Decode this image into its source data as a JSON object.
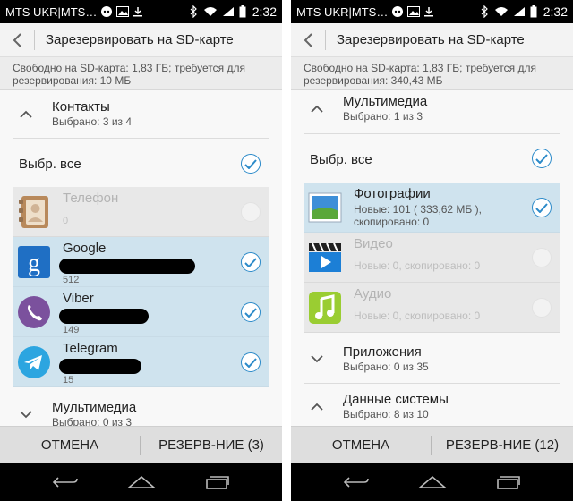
{
  "screens": [
    {
      "status": {
        "carrier": "MTS UKR|MTS…",
        "time": "2:32"
      },
      "title": "Зарезервировать на SD-карте",
      "info": "Свободно на SD-карта: 1,83 ГБ; требуется для резервирования: 10 МБ",
      "group_top": {
        "title": "Контакты",
        "subtitle": "Выбрано: 3 из 4",
        "expanded": true
      },
      "select_all": "Выбр. все",
      "items": [
        {
          "name": "Телефон",
          "count": "0",
          "checked": false
        },
        {
          "name": "Google",
          "count": "512",
          "checked": true
        },
        {
          "name": "Viber",
          "count": "149",
          "checked": true
        },
        {
          "name": "Telegram",
          "count": "15",
          "checked": true
        }
      ],
      "group_bottom": {
        "title": "Мультимедиа",
        "subtitle": "Выбрано: 0 из 3",
        "expanded": false
      },
      "buttons": {
        "cancel": "ОТМЕНА",
        "backup": "РЕЗЕРВ-НИЕ (3)"
      }
    },
    {
      "status": {
        "carrier": "MTS UKR|MTS…",
        "time": "2:32"
      },
      "title": "Зарезервировать на SD-карте",
      "info": "Свободно на SD-карта: 1,83 ГБ; требуется для резервирования: 340,43 МБ",
      "group_top": {
        "title": "Мультимедиа",
        "subtitle": "Выбрано: 1 из 3",
        "expanded": true
      },
      "select_all": "Выбр. все",
      "items": [
        {
          "name": "Фотографии",
          "desc": "Новые: 101 ( 333,62 МБ ), скопировано: 0",
          "checked": true
        },
        {
          "name": "Видео",
          "desc": "Новые: 0, скопировано: 0",
          "checked": false
        },
        {
          "name": "Аудио",
          "desc": "Новые: 0, скопировано: 0",
          "checked": false
        }
      ],
      "groups_after": [
        {
          "title": "Приложения",
          "subtitle": "Выбрано: 0 из 35",
          "expanded": false
        },
        {
          "title": "Данные системы",
          "subtitle": "Выбрано: 8 из 10",
          "expanded": true
        }
      ],
      "buttons": {
        "cancel": "ОТМЕНА",
        "backup": "РЕЗЕРВ-НИЕ (12)"
      }
    }
  ],
  "colors": {
    "accent": "#2b8ac9",
    "selected_row": "#cfe3ee",
    "disabled_row": "#e8e8e8"
  }
}
